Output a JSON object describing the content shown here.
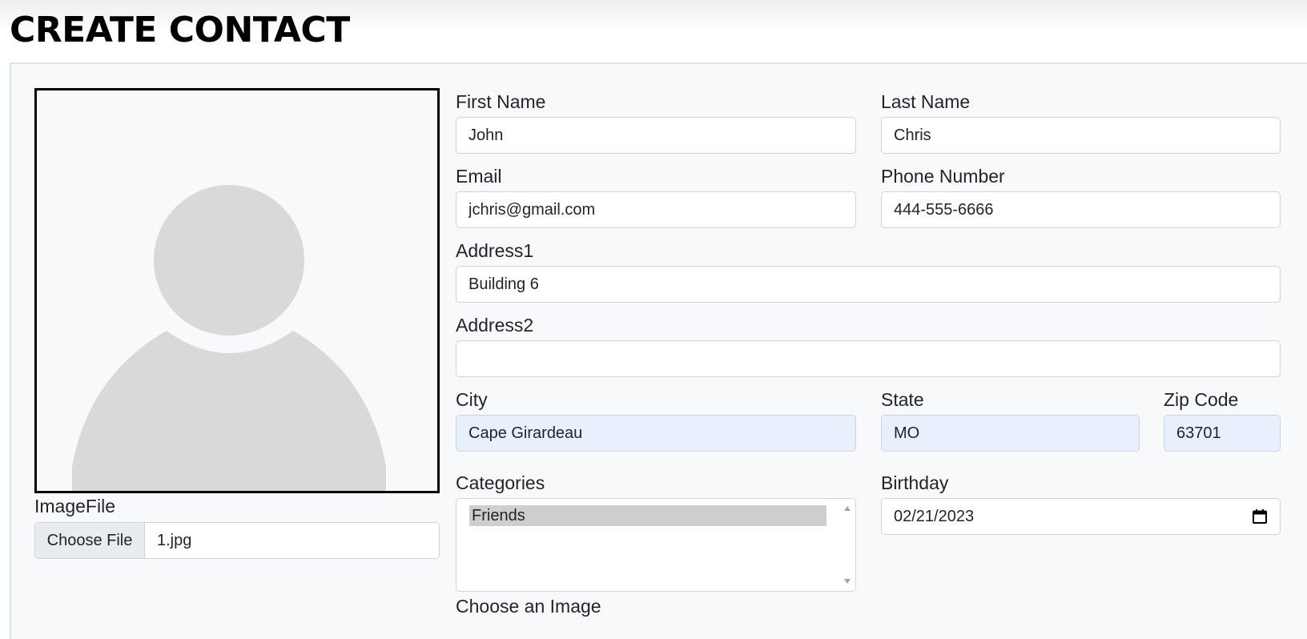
{
  "page": {
    "title": "CREATE CONTACT"
  },
  "form": {
    "first_name": {
      "label": "First Name",
      "value": "John"
    },
    "last_name": {
      "label": "Last Name",
      "value": "Chris"
    },
    "email": {
      "label": "Email",
      "value": "jchris@gmail.com"
    },
    "phone": {
      "label": "Phone Number",
      "value": "444-555-6666"
    },
    "address1": {
      "label": "Address1",
      "value": "Building 6"
    },
    "address2": {
      "label": "Address2",
      "value": ""
    },
    "city": {
      "label": "City",
      "value": "Cape Girardeau"
    },
    "state": {
      "label": "State",
      "value": "MO"
    },
    "zip": {
      "label": "Zip Code",
      "value": "63701"
    },
    "categories": {
      "label": "Categories",
      "options": [
        "Friends"
      ],
      "selected": "Friends"
    },
    "birthday": {
      "label": "Birthday",
      "value": "02/21/2023",
      "icon": "calendar-icon"
    },
    "image_file": {
      "label": "ImageFile",
      "button": "Choose File",
      "filename": "1.jpg"
    },
    "choose_image_label": "Choose an Image"
  },
  "photo": {
    "icon": "avatar-placeholder-icon",
    "color": "#d9d9d9"
  },
  "colors": {
    "autofill": "#e8f0fe",
    "selected_option": "#cecece",
    "card_bg": "#f8f9fa"
  }
}
